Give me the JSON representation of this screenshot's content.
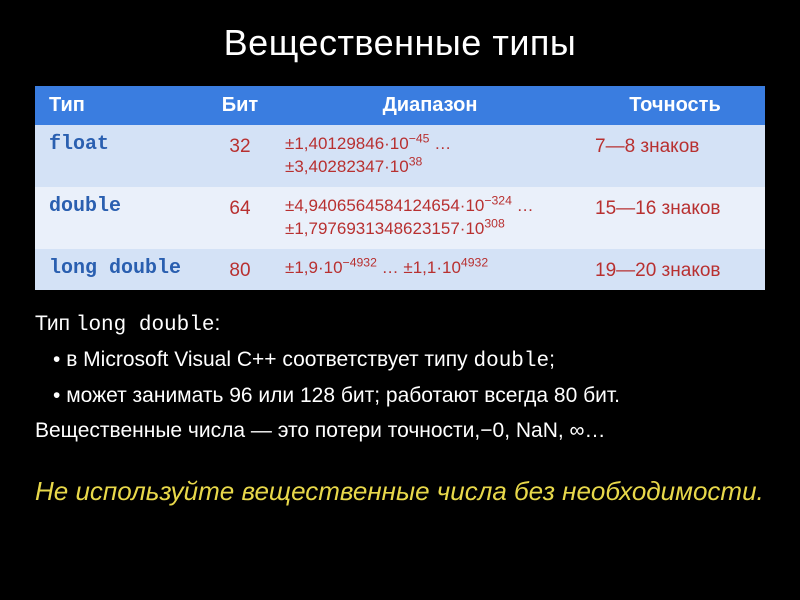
{
  "title": "Вещественные типы",
  "table": {
    "headers": {
      "type": "Тип",
      "bit": "Бит",
      "range": "Диапазон",
      "prec": "Точность"
    },
    "rows": [
      {
        "type": "float",
        "bit": "32",
        "range_html": "±1,40129846·10<sup>−45</sup> …<br>±3,40282347·10<sup>38</sup>",
        "prec": "7—8 знаков"
      },
      {
        "type": "double",
        "bit": "64",
        "range_html": "±4,9406564584124654·10<sup>−324</sup> …<br>±1,7976931348623157·10<sup>308</sup>",
        "prec": "15—16 знаков"
      },
      {
        "type": "long double",
        "bit": "80",
        "range_html": "±1,9·10<sup>−4932</sup> … ±1,1·10<sup>4932</sup>",
        "prec": "19—20 знаков"
      }
    ]
  },
  "body": {
    "intro_pre": "Тип ",
    "intro_code": "long double",
    "intro_post": ":",
    "bullets": [
      {
        "pre": "в Microsoft Visual C++ соответствует типу ",
        "code": "double",
        "post": ";"
      },
      {
        "text": "может занимать 96 или 128 бит; работают всегда 80 бит."
      }
    ],
    "real_note": "Вещественные числа — это потери точности,−0, NaN, ∞…"
  },
  "footnote": "Не используйте вещественные числа без необходимости.",
  "chart_data": {
    "type": "table",
    "title": "Вещественные типы",
    "columns": [
      "Тип",
      "Бит",
      "Диапазон",
      "Точность"
    ],
    "rows": [
      [
        "float",
        32,
        "±1,40129846·10^−45 … ±3,40282347·10^38",
        "7—8 знаков"
      ],
      [
        "double",
        64,
        "±4,9406564584124654·10^−324 … ±1,7976931348623157·10^308",
        "15—16 знаков"
      ],
      [
        "long double",
        80,
        "±1,9·10^−4932 … ±1,1·10^4932",
        "19—20 знаков"
      ]
    ]
  }
}
